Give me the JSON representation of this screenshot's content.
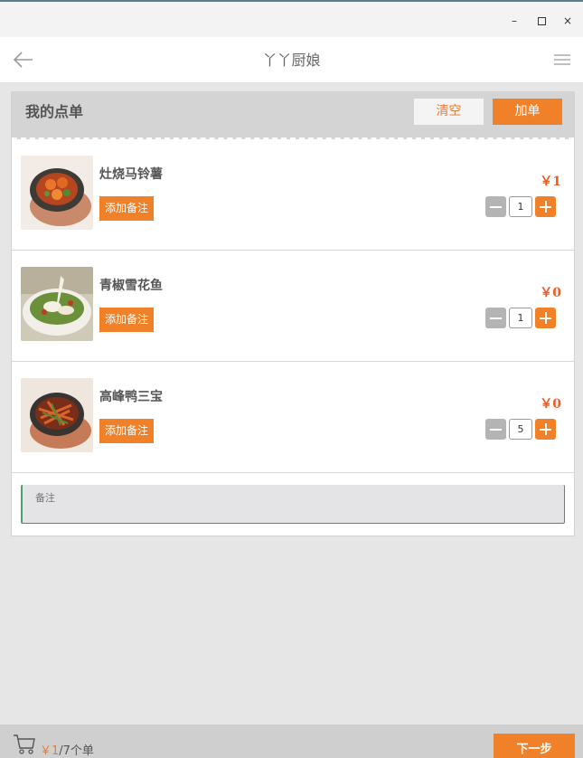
{
  "window": {
    "min_label": "–",
    "close_label": "×"
  },
  "appbar": {
    "title": "丫丫厨娘"
  },
  "order": {
    "title": "我的点单",
    "clear_label": "清空",
    "add_label": "加单",
    "items": [
      {
        "name": "灶烧马铃薯",
        "note_label": "添加备注",
        "price": "￥1",
        "qty": "1"
      },
      {
        "name": "青椒雪花鱼",
        "note_label": "添加备注",
        "price": "￥0",
        "qty": "1"
      },
      {
        "name": "高峰鸭三宝",
        "note_label": "添加备注",
        "price": "￥0",
        "qty": "5"
      }
    ],
    "remark_placeholder": "备注"
  },
  "footer": {
    "amount": "￥1",
    "count": "/7个单",
    "next_label": "下一步"
  },
  "colors": {
    "accent": "#f08128",
    "price": "#ee5a24",
    "remark_border": "#49a06a"
  }
}
